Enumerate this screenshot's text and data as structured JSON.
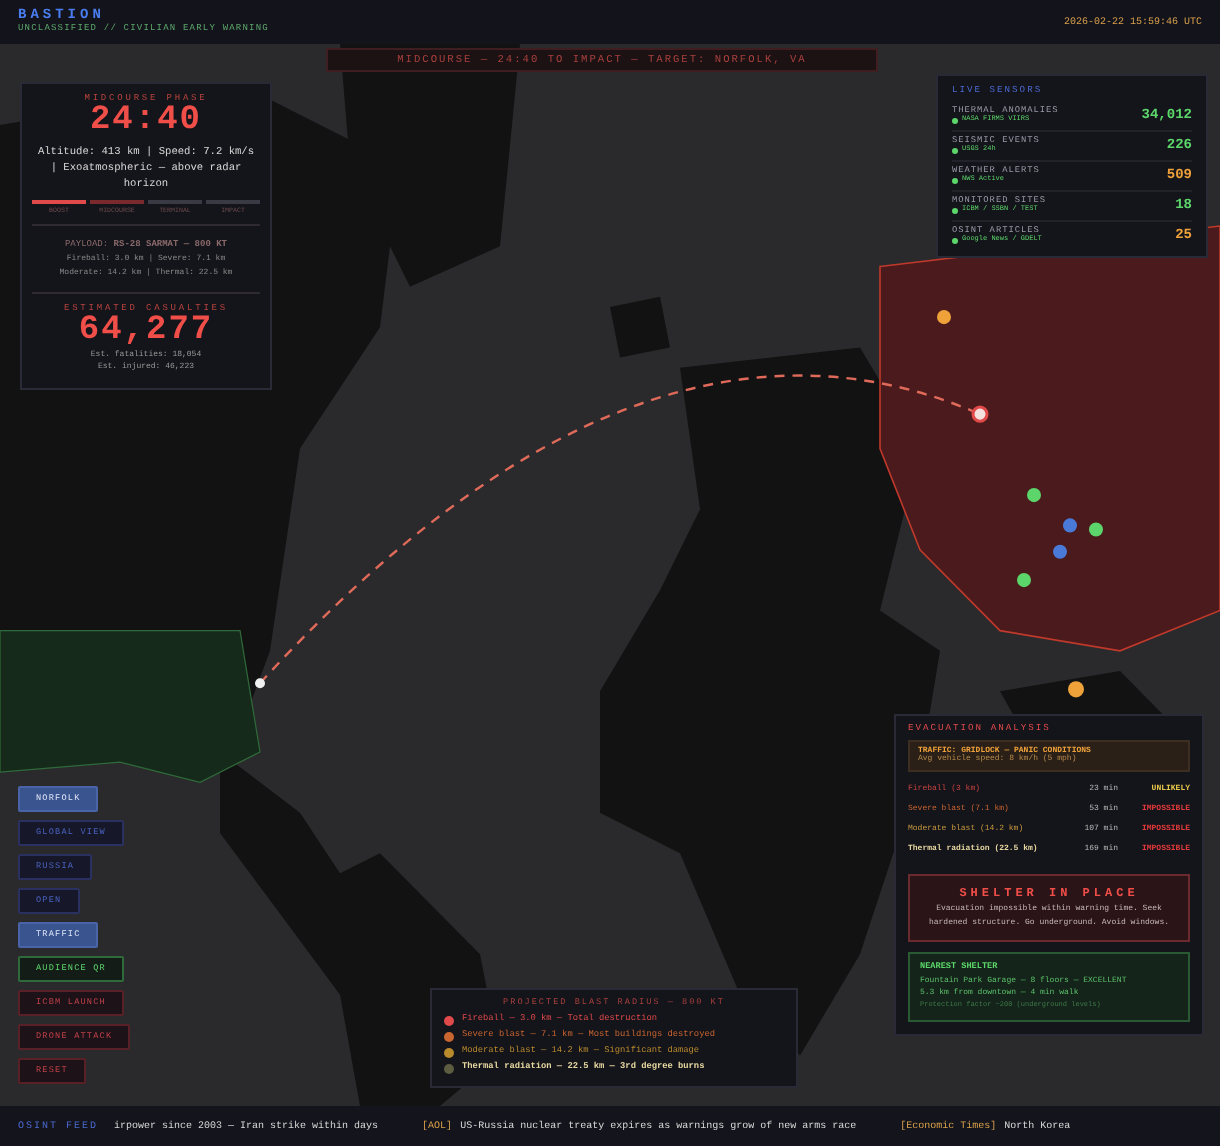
{
  "header": {
    "title": "BASTION",
    "subtitle": "UNCLASSIFIED // CIVILIAN EARLY WARNING",
    "timestamp": "2026-02-22 15:59:46 UTC"
  },
  "banner": "MIDCOURSE — 24:40 TO IMPACT — TARGET: NORFOLK, VA",
  "phase_panel": {
    "phase": "MIDCOURSE PHASE",
    "countdown": "24:40",
    "details": "Altitude: 413 km | Speed: 7.2 km/s | Exoatmospheric — above radar horizon",
    "stages": [
      {
        "label": "BOOST",
        "done": true,
        "active": false
      },
      {
        "label": "MIDCOURSE",
        "done": false,
        "active": true
      },
      {
        "label": "TERMINAL",
        "done": false,
        "active": false
      },
      {
        "label": "IMPACT",
        "done": false,
        "active": false
      }
    ],
    "payload": "PAYLOAD: **RS-28 SARMAT — 800 KT**",
    "radii": [
      "Fireball: 3.0 km | Severe: 7.1 km",
      "Moderate: 14.2 km | Thermal: 22.5 km"
    ],
    "casualties_label": "ESTIMATED CASUALTIES",
    "casualties": "64,277",
    "fatalities": "Est. fatalities: 18,054",
    "injured": "Est. injured: 46,223"
  },
  "sensors": {
    "title": "LIVE SENSORS",
    "items": [
      {
        "name": "THERMAL ANOMALIES",
        "source": "NASA FIRMS VIIRS",
        "value": "34,012",
        "live": true,
        "color": "#5cd66a"
      },
      {
        "name": "SEISMIC EVENTS",
        "source": "USGS 24h",
        "value": "226",
        "live": true,
        "color": "#5cd66a"
      },
      {
        "name": "WEATHER ALERTS",
        "source": "NWS Active",
        "value": "509",
        "live": true,
        "color": "#f0a23a"
      },
      {
        "name": "MONITORED SITES",
        "source": "ICBM / SSBN / TEST",
        "value": "18",
        "live": true,
        "color": "#5cd66a"
      },
      {
        "name": "OSINT ARTICLES",
        "source": "Google News / GDELT",
        "value": "25",
        "live": true,
        "color": "#f0a23a"
      }
    ]
  },
  "controls": [
    {
      "label": "NORFOLK",
      "kind": "nav",
      "selected": true
    },
    {
      "label": "GLOBAL VIEW",
      "kind": "nav",
      "selected": false
    },
    {
      "label": "RUSSIA",
      "kind": "nav",
      "selected": false
    },
    {
      "label": "OPEN",
      "kind": "nav",
      "selected": false
    },
    {
      "label": "TRAFFIC",
      "kind": "nav",
      "selected": true
    },
    {
      "label": "AUDIENCE QR",
      "kind": "qr",
      "selected": false
    },
    {
      "label": "ICBM LAUNCH",
      "kind": "danger",
      "selected": false
    },
    {
      "label": "DRONE ATTACK",
      "kind": "danger",
      "selected": false
    },
    {
      "label": "RESET",
      "kind": "danger",
      "selected": false
    }
  ],
  "blast_legend": {
    "title": "PROJECTED BLAST RADIUS — 800 KT",
    "items": [
      {
        "text": "Fireball — 3.0 km — Total destruction",
        "color": "#e04a4a"
      },
      {
        "text": "Severe blast — 7.1 km — Most buildings destroyed",
        "color": "#c9652f"
      },
      {
        "text": "Moderate blast — 14.2 km — Significant damage",
        "color": "#b98a2c"
      },
      {
        "text": "Thermal radiation — 22.5 km — 3rd degree burns",
        "color": "#5c5c40"
      }
    ]
  },
  "evacuation": {
    "title": "EVACUATION ANALYSIS",
    "traffic_title": "TRAFFIC: GRIDLOCK — PANIC CONDITIONS",
    "traffic_detail": "Avg vehicle speed: 8 km/h (5 mph)",
    "rows": [
      {
        "kind": "fireball",
        "zone": "Fireball (3 km)",
        "time": "23 min",
        "verdict": "UNLIKELY",
        "impossible": false
      },
      {
        "kind": "severe",
        "zone": "Severe blast (7.1 km)",
        "time": "53 min",
        "verdict": "IMPOSSIBLE",
        "impossible": true
      },
      {
        "kind": "moderate",
        "zone": "Moderate blast (14.2 km)",
        "time": "107 min",
        "verdict": "IMPOSSIBLE",
        "impossible": true
      },
      {
        "kind": "thermal",
        "zone": "Thermal radiation (22.5 km)",
        "time": "169 min",
        "verdict": "IMPOSSIBLE",
        "impossible": true
      }
    ],
    "shelter_title": "SHELTER IN PLACE",
    "shelter_text": "Evacuation impossible within warning time. Seek hardened structure. Go underground. Avoid windows.",
    "nearest_title": "NEAREST SHELTER",
    "nearest_lines": [
      "Fountain Park Garage — 8 floors — EXCELLENT",
      "5.3 km from downtown — 4 min walk"
    ],
    "nearest_note": "Protection factor ~200 (underground levels)"
  },
  "ticker": {
    "label": "OSINT FEED",
    "items": [
      {
        "text": "irpower since 2003 — Iran strike within days"
      },
      {
        "source": "[AOL]",
        "text": "US-Russia nuclear treaty expires as warnings grow of new arms race"
      },
      {
        "source": "[Economic Times]",
        "text": "North Korea"
      }
    ]
  }
}
